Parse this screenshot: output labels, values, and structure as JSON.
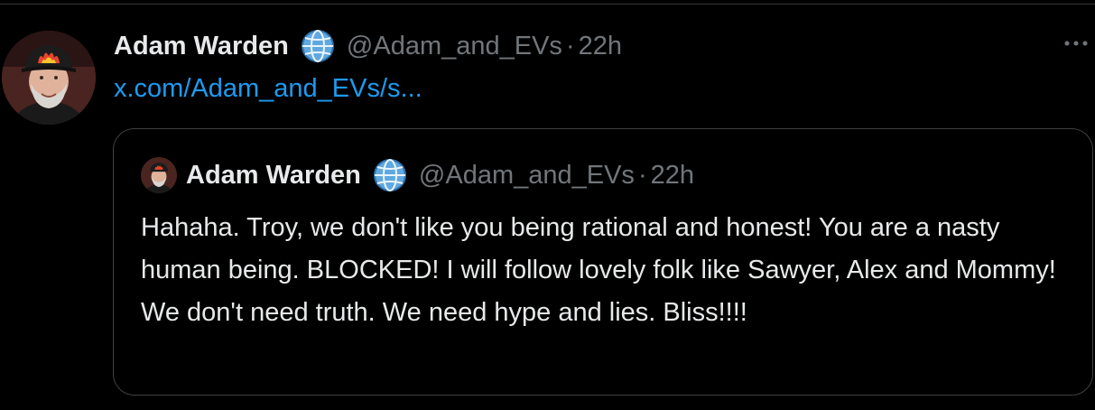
{
  "post": {
    "author_name": "Adam Warden",
    "handle": "@Adam_and_EVs",
    "separator": "·",
    "time": "22h",
    "link_text": "x.com/Adam_and_EVs/s..."
  },
  "quoted_post": {
    "author_name": "Adam Warden",
    "handle": "@Adam_and_EVs",
    "separator": "·",
    "time": "22h",
    "text": "Hahaha. Troy, we don't like you being rational and honest! You are a nasty human being. BLOCKED! I will follow lovely folk like Sawyer, Alex and Mommy! We don't need truth. We need hype and lies. Bliss!!!!"
  },
  "icons": {
    "badge": "globe-icon",
    "menu": "more-options-icon"
  },
  "colors": {
    "background": "#000000",
    "text_primary": "#e7e9ea",
    "text_secondary": "#71767b",
    "link": "#1d9bf0",
    "border": "#3e4144"
  }
}
